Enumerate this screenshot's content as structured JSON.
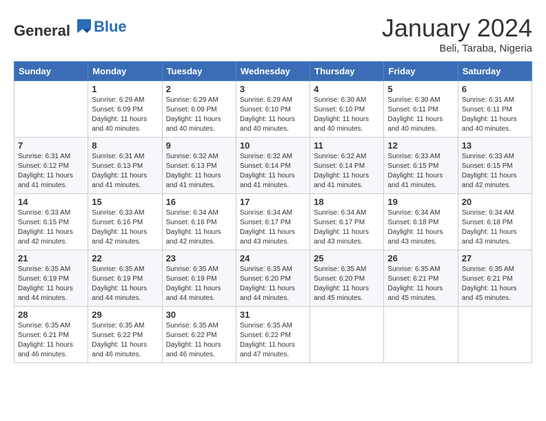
{
  "logo": {
    "general": "General",
    "blue": "Blue"
  },
  "header": {
    "month": "January 2024",
    "location": "Beli, Taraba, Nigeria"
  },
  "weekdays": [
    "Sunday",
    "Monday",
    "Tuesday",
    "Wednesday",
    "Thursday",
    "Friday",
    "Saturday"
  ],
  "weeks": [
    [
      {
        "day": "",
        "sunrise": "",
        "sunset": "",
        "daylight": ""
      },
      {
        "day": "1",
        "sunrise": "Sunrise: 6:29 AM",
        "sunset": "Sunset: 6:09 PM",
        "daylight": "Daylight: 11 hours and 40 minutes."
      },
      {
        "day": "2",
        "sunrise": "Sunrise: 6:29 AM",
        "sunset": "Sunset: 6:09 PM",
        "daylight": "Daylight: 11 hours and 40 minutes."
      },
      {
        "day": "3",
        "sunrise": "Sunrise: 6:29 AM",
        "sunset": "Sunset: 6:10 PM",
        "daylight": "Daylight: 11 hours and 40 minutes."
      },
      {
        "day": "4",
        "sunrise": "Sunrise: 6:30 AM",
        "sunset": "Sunset: 6:10 PM",
        "daylight": "Daylight: 11 hours and 40 minutes."
      },
      {
        "day": "5",
        "sunrise": "Sunrise: 6:30 AM",
        "sunset": "Sunset: 6:11 PM",
        "daylight": "Daylight: 11 hours and 40 minutes."
      },
      {
        "day": "6",
        "sunrise": "Sunrise: 6:31 AM",
        "sunset": "Sunset: 6:11 PM",
        "daylight": "Daylight: 11 hours and 40 minutes."
      }
    ],
    [
      {
        "day": "7",
        "sunrise": "Sunrise: 6:31 AM",
        "sunset": "Sunset: 6:12 PM",
        "daylight": "Daylight: 11 hours and 41 minutes."
      },
      {
        "day": "8",
        "sunrise": "Sunrise: 6:31 AM",
        "sunset": "Sunset: 6:13 PM",
        "daylight": "Daylight: 11 hours and 41 minutes."
      },
      {
        "day": "9",
        "sunrise": "Sunrise: 6:32 AM",
        "sunset": "Sunset: 6:13 PM",
        "daylight": "Daylight: 11 hours and 41 minutes."
      },
      {
        "day": "10",
        "sunrise": "Sunrise: 6:32 AM",
        "sunset": "Sunset: 6:14 PM",
        "daylight": "Daylight: 11 hours and 41 minutes."
      },
      {
        "day": "11",
        "sunrise": "Sunrise: 6:32 AM",
        "sunset": "Sunset: 6:14 PM",
        "daylight": "Daylight: 11 hours and 41 minutes."
      },
      {
        "day": "12",
        "sunrise": "Sunrise: 6:33 AM",
        "sunset": "Sunset: 6:15 PM",
        "daylight": "Daylight: 11 hours and 41 minutes."
      },
      {
        "day": "13",
        "sunrise": "Sunrise: 6:33 AM",
        "sunset": "Sunset: 6:15 PM",
        "daylight": "Daylight: 11 hours and 42 minutes."
      }
    ],
    [
      {
        "day": "14",
        "sunrise": "Sunrise: 6:33 AM",
        "sunset": "Sunset: 6:15 PM",
        "daylight": "Daylight: 11 hours and 42 minutes."
      },
      {
        "day": "15",
        "sunrise": "Sunrise: 6:33 AM",
        "sunset": "Sunset: 6:16 PM",
        "daylight": "Daylight: 11 hours and 42 minutes."
      },
      {
        "day": "16",
        "sunrise": "Sunrise: 6:34 AM",
        "sunset": "Sunset: 6:16 PM",
        "daylight": "Daylight: 11 hours and 42 minutes."
      },
      {
        "day": "17",
        "sunrise": "Sunrise: 6:34 AM",
        "sunset": "Sunset: 6:17 PM",
        "daylight": "Daylight: 11 hours and 43 minutes."
      },
      {
        "day": "18",
        "sunrise": "Sunrise: 6:34 AM",
        "sunset": "Sunset: 6:17 PM",
        "daylight": "Daylight: 11 hours and 43 minutes."
      },
      {
        "day": "19",
        "sunrise": "Sunrise: 6:34 AM",
        "sunset": "Sunset: 6:18 PM",
        "daylight": "Daylight: 11 hours and 43 minutes."
      },
      {
        "day": "20",
        "sunrise": "Sunrise: 6:34 AM",
        "sunset": "Sunset: 6:18 PM",
        "daylight": "Daylight: 11 hours and 43 minutes."
      }
    ],
    [
      {
        "day": "21",
        "sunrise": "Sunrise: 6:35 AM",
        "sunset": "Sunset: 6:19 PM",
        "daylight": "Daylight: 11 hours and 44 minutes."
      },
      {
        "day": "22",
        "sunrise": "Sunrise: 6:35 AM",
        "sunset": "Sunset: 6:19 PM",
        "daylight": "Daylight: 11 hours and 44 minutes."
      },
      {
        "day": "23",
        "sunrise": "Sunrise: 6:35 AM",
        "sunset": "Sunset: 6:19 PM",
        "daylight": "Daylight: 11 hours and 44 minutes."
      },
      {
        "day": "24",
        "sunrise": "Sunrise: 6:35 AM",
        "sunset": "Sunset: 6:20 PM",
        "daylight": "Daylight: 11 hours and 44 minutes."
      },
      {
        "day": "25",
        "sunrise": "Sunrise: 6:35 AM",
        "sunset": "Sunset: 6:20 PM",
        "daylight": "Daylight: 11 hours and 45 minutes."
      },
      {
        "day": "26",
        "sunrise": "Sunrise: 6:35 AM",
        "sunset": "Sunset: 6:21 PM",
        "daylight": "Daylight: 11 hours and 45 minutes."
      },
      {
        "day": "27",
        "sunrise": "Sunrise: 6:35 AM",
        "sunset": "Sunset: 6:21 PM",
        "daylight": "Daylight: 11 hours and 45 minutes."
      }
    ],
    [
      {
        "day": "28",
        "sunrise": "Sunrise: 6:35 AM",
        "sunset": "Sunset: 6:21 PM",
        "daylight": "Daylight: 11 hours and 46 minutes."
      },
      {
        "day": "29",
        "sunrise": "Sunrise: 6:35 AM",
        "sunset": "Sunset: 6:22 PM",
        "daylight": "Daylight: 11 hours and 46 minutes."
      },
      {
        "day": "30",
        "sunrise": "Sunrise: 6:35 AM",
        "sunset": "Sunset: 6:22 PM",
        "daylight": "Daylight: 11 hours and 46 minutes."
      },
      {
        "day": "31",
        "sunrise": "Sunrise: 6:35 AM",
        "sunset": "Sunset: 6:22 PM",
        "daylight": "Daylight: 11 hours and 47 minutes."
      },
      {
        "day": "",
        "sunrise": "",
        "sunset": "",
        "daylight": ""
      },
      {
        "day": "",
        "sunrise": "",
        "sunset": "",
        "daylight": ""
      },
      {
        "day": "",
        "sunrise": "",
        "sunset": "",
        "daylight": ""
      }
    ]
  ]
}
